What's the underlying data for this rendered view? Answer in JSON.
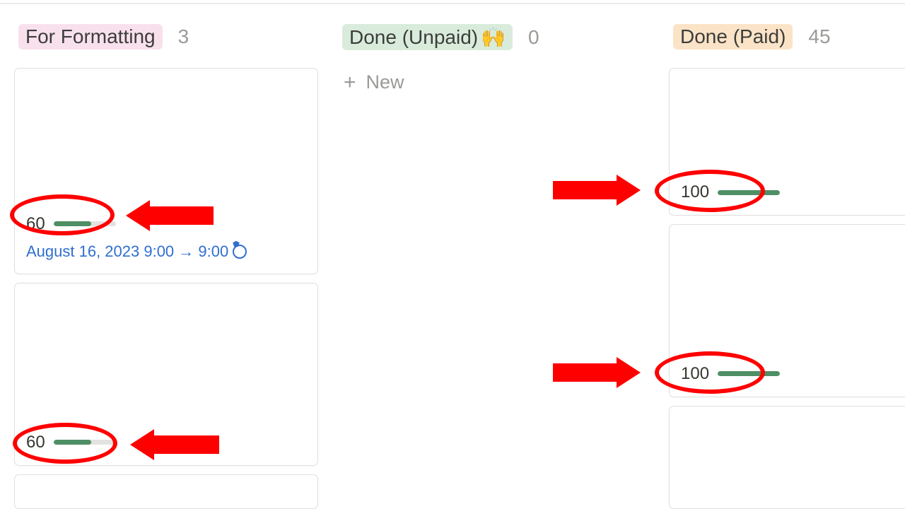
{
  "columns": {
    "formatting": {
      "title": "For Formatting",
      "count": "3"
    },
    "unpaid": {
      "title": "Done (Unpaid)",
      "emoji": "🙌",
      "count": "0",
      "new_label": "New"
    },
    "paid": {
      "title": "Done (Paid)",
      "count": "45"
    }
  },
  "cards": {
    "formatting": [
      {
        "progress_value": "60",
        "progress_pct": 60,
        "date_text": "August 16, 2023 9:00 → 9:00"
      },
      {
        "progress_value": "60",
        "progress_pct": 60
      }
    ],
    "paid": [
      {
        "progress_value": "100",
        "progress_pct": 100
      },
      {
        "progress_value": "100",
        "progress_pct": 100
      }
    ]
  },
  "annotation_color": "#ff0000"
}
